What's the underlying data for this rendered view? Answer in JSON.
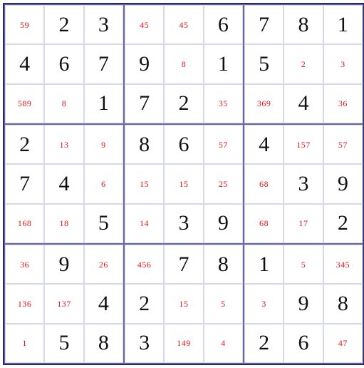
{
  "sudoku": {
    "colors": {
      "given": "#111111",
      "candidate": "#ee1111",
      "border_outer": "#2a2a6a",
      "border_box": "#6a6aa0",
      "border_cell": "#d8d8ec"
    },
    "grid": [
      [
        {
          "t": "c",
          "v": "59"
        },
        {
          "t": "g",
          "v": "2"
        },
        {
          "t": "g",
          "v": "3"
        },
        {
          "t": "c",
          "v": "45"
        },
        {
          "t": "c",
          "v": "45"
        },
        {
          "t": "g",
          "v": "6"
        },
        {
          "t": "g",
          "v": "7"
        },
        {
          "t": "g",
          "v": "8"
        },
        {
          "t": "g",
          "v": "1"
        }
      ],
      [
        {
          "t": "g",
          "v": "4"
        },
        {
          "t": "g",
          "v": "6"
        },
        {
          "t": "g",
          "v": "7"
        },
        {
          "t": "g",
          "v": "9"
        },
        {
          "t": "c",
          "v": "8"
        },
        {
          "t": "g",
          "v": "1"
        },
        {
          "t": "g",
          "v": "5"
        },
        {
          "t": "c",
          "v": "2"
        },
        {
          "t": "c",
          "v": "3"
        }
      ],
      [
        {
          "t": "c",
          "v": "589"
        },
        {
          "t": "c",
          "v": "8"
        },
        {
          "t": "g",
          "v": "1"
        },
        {
          "t": "g",
          "v": "7"
        },
        {
          "t": "g",
          "v": "2"
        },
        {
          "t": "c",
          "v": "35"
        },
        {
          "t": "c",
          "v": "369"
        },
        {
          "t": "g",
          "v": "4"
        },
        {
          "t": "c",
          "v": "36"
        }
      ],
      [
        {
          "t": "g",
          "v": "2"
        },
        {
          "t": "c",
          "v": "13"
        },
        {
          "t": "c",
          "v": "9"
        },
        {
          "t": "g",
          "v": "8"
        },
        {
          "t": "g",
          "v": "6"
        },
        {
          "t": "c",
          "v": "57"
        },
        {
          "t": "g",
          "v": "4"
        },
        {
          "t": "c",
          "v": "157"
        },
        {
          "t": "c",
          "v": "57"
        }
      ],
      [
        {
          "t": "g",
          "v": "7"
        },
        {
          "t": "g",
          "v": "4"
        },
        {
          "t": "c",
          "v": "6"
        },
        {
          "t": "c",
          "v": "15"
        },
        {
          "t": "c",
          "v": "15"
        },
        {
          "t": "c",
          "v": "25"
        },
        {
          "t": "c",
          "v": "68"
        },
        {
          "t": "g",
          "v": "3"
        },
        {
          "t": "g",
          "v": "9"
        }
      ],
      [
        {
          "t": "c",
          "v": "168"
        },
        {
          "t": "c",
          "v": "18"
        },
        {
          "t": "g",
          "v": "5"
        },
        {
          "t": "c",
          "v": "14"
        },
        {
          "t": "g",
          "v": "3"
        },
        {
          "t": "g",
          "v": "9"
        },
        {
          "t": "c",
          "v": "68"
        },
        {
          "t": "c",
          "v": "17"
        },
        {
          "t": "g",
          "v": "2"
        }
      ],
      [
        {
          "t": "c",
          "v": "36"
        },
        {
          "t": "g",
          "v": "9"
        },
        {
          "t": "c",
          "v": "26"
        },
        {
          "t": "c",
          "v": "456"
        },
        {
          "t": "g",
          "v": "7"
        },
        {
          "t": "g",
          "v": "8"
        },
        {
          "t": "g",
          "v": "1"
        },
        {
          "t": "c",
          "v": "5"
        },
        {
          "t": "c",
          "v": "345"
        }
      ],
      [
        {
          "t": "c",
          "v": "136"
        },
        {
          "t": "c",
          "v": "137"
        },
        {
          "t": "g",
          "v": "4"
        },
        {
          "t": "g",
          "v": "2"
        },
        {
          "t": "c",
          "v": "15"
        },
        {
          "t": "c",
          "v": "5"
        },
        {
          "t": "c",
          "v": "3"
        },
        {
          "t": "g",
          "v": "9"
        },
        {
          "t": "g",
          "v": "8"
        }
      ],
      [
        {
          "t": "c",
          "v": "1"
        },
        {
          "t": "g",
          "v": "5"
        },
        {
          "t": "g",
          "v": "8"
        },
        {
          "t": "g",
          "v": "3"
        },
        {
          "t": "c",
          "v": "149"
        },
        {
          "t": "c",
          "v": "4"
        },
        {
          "t": "g",
          "v": "2"
        },
        {
          "t": "g",
          "v": "6"
        },
        {
          "t": "c",
          "v": "47"
        }
      ]
    ]
  }
}
